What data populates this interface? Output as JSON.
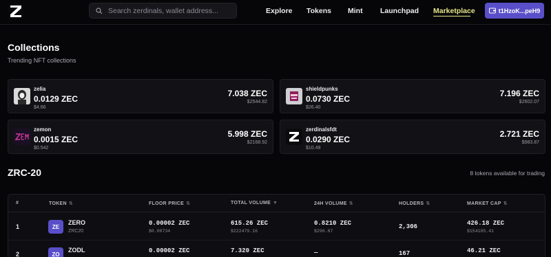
{
  "header": {
    "logo_icon": "zerdinals-z-logo-icon",
    "search_placeholder": "Search zerdinals, wallet address...",
    "nav": [
      "Explore",
      "Tokens",
      "Mint",
      "Launchpad",
      "Marketplace"
    ],
    "active_nav": "Marketplace",
    "wallet_label": "t1HzoK...peH9",
    "accent": "#5a4fc9",
    "active_color": "#e6e58a"
  },
  "collections": {
    "title": "Collections",
    "subtitle": "Trending NFT collections",
    "items": [
      {
        "name": "zelia",
        "floor": "0.0129 ZEC",
        "floor_usd": "$4.66",
        "volume": "7.038 ZEC",
        "volume_usd": "$2544.82",
        "icon": "zelia-avatar-icon"
      },
      {
        "name": "shieldpunks",
        "floor": "0.0730 ZEC",
        "floor_usd": "$26.40",
        "volume": "7.196 ZEC",
        "volume_usd": "$2602.07",
        "icon": "shieldpunks-avatar-icon"
      },
      {
        "name": "zemon",
        "floor": "0.0015 ZEC",
        "floor_usd": "$0.542",
        "volume": "5.998 ZEC",
        "volume_usd": "$2168.92",
        "icon": "zemon-avatar-icon"
      },
      {
        "name": "zerdinalsfdt",
        "floor": "0.0290 ZEC",
        "floor_usd": "$10.49",
        "volume": "2.721 ZEC",
        "volume_usd": "$983.87",
        "icon": "zerdinalsfdt-avatar-icon"
      }
    ]
  },
  "zrc20": {
    "title": "ZRC-20",
    "count_text": "8 tokens available for trading",
    "columns": [
      "#",
      "TOKEN",
      "FLOOR PRICE",
      "TOTAL VOLUME",
      "24H VOLUME",
      "HOLDERS",
      "MARKET CAP"
    ],
    "rows": [
      {
        "rank": "1",
        "icon_text": "ZE",
        "token": "ZERO",
        "standard": "ZRC20",
        "floor": "0.00002 ZEC",
        "floor_usd": "$0.00734",
        "total_volume": "615.26 ZEC",
        "total_volume_usd": "$222479.16",
        "vol24": "0.8210 ZEC",
        "vol24_usd": "$296.87",
        "holders": "2,306",
        "mcap": "426.18 ZEC",
        "mcap_usd": "$154105.41"
      },
      {
        "rank": "2",
        "icon_text": "ZO",
        "token": "ZODL",
        "standard": "",
        "floor": "0.00002 ZEC",
        "floor_usd": "",
        "total_volume": "7.320 ZEC",
        "total_volume_usd": "",
        "vol24": "—",
        "vol24_usd": "",
        "holders": "167",
        "mcap": "46.21 ZEC",
        "mcap_usd": ""
      }
    ]
  }
}
